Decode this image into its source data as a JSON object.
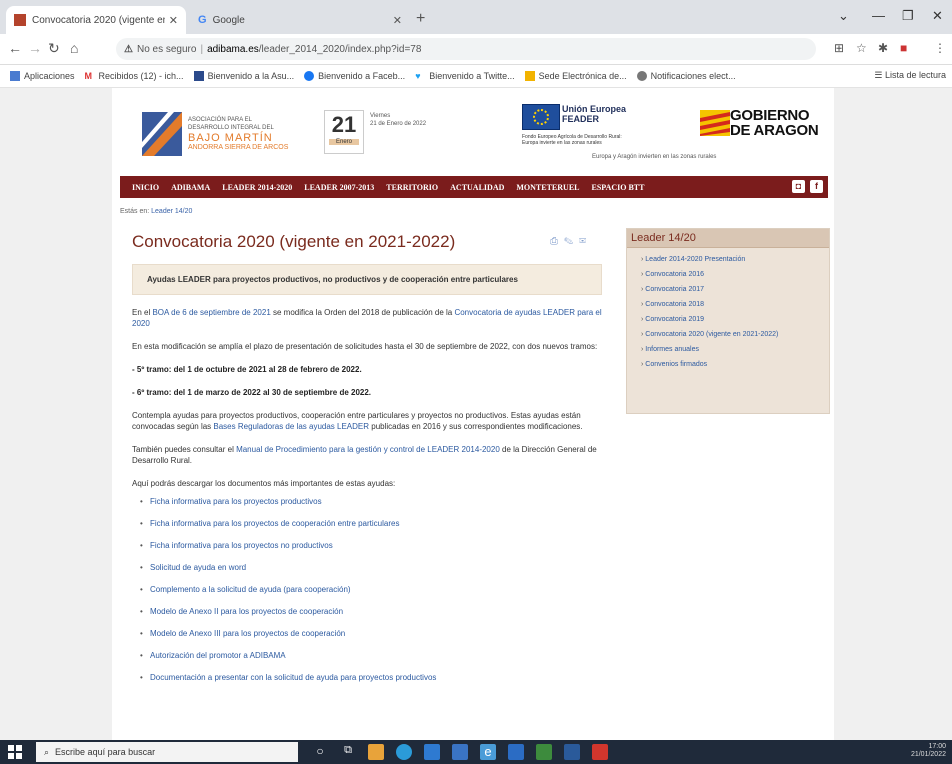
{
  "browser": {
    "tabs": [
      {
        "title": "Convocatoria 2020 (vigente en 2021-2022)",
        "active": true
      },
      {
        "title": "Google",
        "active": false
      }
    ],
    "address": {
      "warning": "No es seguro",
      "host": "adibama.es",
      "path": "/leader_2014_2020/index.php?id=78"
    },
    "bookmarks": [
      "Aplicaciones",
      "Recibidos (12) - ich...",
      "Bienvenido a la Asu...",
      "Bienvenido a Faceb...",
      "Bienvenido a Twitte...",
      "Sede Electrónica de...",
      "Notificaciones elect..."
    ],
    "reading_list": "Lista de lectura"
  },
  "site": {
    "logo": {
      "line1": "ASOCIACIÓN PARA EL",
      "line2": "DESARROLLO INTEGRAL DEL",
      "name": "BAJO MARTÍN",
      "line3": "ANDORRA SIERRA DE ARCOS"
    },
    "date": {
      "day": "21",
      "month": "Enero",
      "weekday": "Viernes",
      "full": "21 de Enero de 2022"
    },
    "eu": {
      "title1": "Unión Europea",
      "title2": "FEADER",
      "sub": "Fondo Europeo Agrícola de Desarrollo Rural: Europa invierte en las zonas rurales"
    },
    "gov": {
      "line1": "GOBIERNO",
      "line2": "DE ARAGON",
      "sub": "Europa y Aragón invierten en las zonas rurales"
    },
    "nav": [
      "INICIO",
      "ADIBAMA",
      "LEADER 2014-2020",
      "LEADER 2007-2013",
      "TERRITORIO",
      "ACTUALIDAD",
      "MONTETERUEL",
      "ESPACIO BTT"
    ],
    "breadcrumb": {
      "label": "Estás en:",
      "link": "Leader 14/20"
    }
  },
  "article": {
    "title": "Convocatoria 2020 (vigente en 2021-2022)",
    "highlight": "Ayudas LEADER para proyectos productivos, no productivos y de cooperación entre particulares",
    "p1_a": "En el ",
    "p1_link1": "BOA de 6 de septiembre de 2021",
    "p1_b": " se modifica la Orden del 2018 de publicación de la ",
    "p1_link2": "Convocatoria de ayudas LEADER para el 2020",
    "p2": "En esta modificación se amplía el plazo de presentación de solicitudes hasta el 30 de septiembre de 2022, con dos nuevos tramos:",
    "p3": "- 5º tramo:  del 1 de octubre de 2021 al 28 de febrero de 2022.",
    "p4": "- 6º tramo: del 1 de marzo de 2022 al 30 de septiembre de 2022.",
    "p5_a": "Contempla ayudas para proyectos productivos, cooperación entre particulares y proyectos no productivos. Estas ayudas están convocadas según las ",
    "p5_link": "Bases Reguladoras de las ayudas LEADER",
    "p5_b": " publicadas en 2016 y sus correspondientes modificaciones.",
    "p6_a": "También puedes consultar el ",
    "p6_link": "Manual de Procedimiento para la gestión y control de LEADER 2014-2020",
    "p6_b": " de la Dirección General de Desarrollo Rural.",
    "p7": "Aquí podrás descargar los documentos más importantes de estas ayudas:",
    "downloads": [
      "Ficha informativa para los proyectos productivos",
      "Ficha informativa para los proyectos de cooperación entre particulares",
      "Ficha informativa para los proyectos no productivos",
      "Solicitud de ayuda en word",
      "Complemento a la solicitud de ayuda (para cooperación)",
      "Modelo de Anexo II para los proyectos de cooperación",
      "Modelo de Anexo III para los proyectos de cooperación",
      "Autorización del promotor a ADIBAMA",
      "Documentación a presentar con la solicitud de ayuda para proyectos productivos"
    ]
  },
  "sidebar": {
    "title": "Leader 14/20",
    "items": [
      "Leader 2014-2020 Presentación",
      "Convocatoria 2016",
      "Convocatoria 2017",
      "Convocatoria 2018",
      "Convocatoria 2019",
      "Convocatoria 2020 (vigente en 2021-2022)",
      "Informes anuales",
      "Convenios firmados"
    ]
  },
  "taskbar": {
    "search_placeholder": "Escribe aquí para buscar",
    "time": "17:00",
    "date": "21/01/2022"
  },
  "colors": {
    "nav": "#7b1c1c",
    "title": "#7a2b1e",
    "link": "#2c5aa0",
    "highlight_bg": "#f4ecdf",
    "sidebar_bg": "#ede3d8"
  }
}
